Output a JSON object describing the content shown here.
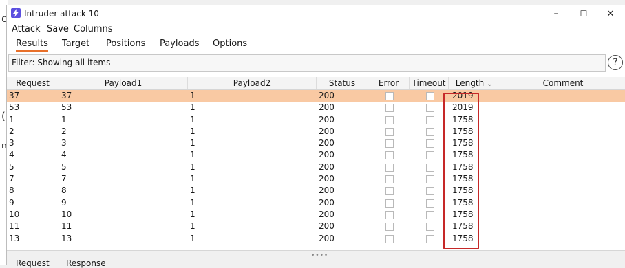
{
  "bg_fragments": [
    "o",
    "(",
    "ne"
  ],
  "window": {
    "title": "Intruder attack 10",
    "minimize": "–",
    "maximize": "☐",
    "close": "✕"
  },
  "menu": [
    "Attack",
    "Save",
    "Columns"
  ],
  "tabs": [
    "Results",
    "Target",
    "Positions",
    "Payloads",
    "Options"
  ],
  "filter": {
    "text": "Filter: Showing all items",
    "help": "?"
  },
  "columns": {
    "request": "Request",
    "payload1": "Payload1",
    "payload2": "Payload2",
    "status": "Status",
    "error": "Error",
    "timeout": "Timeout",
    "length": "Length",
    "length_sort_icon": "⌄",
    "comment": "Comment"
  },
  "rows": [
    {
      "request": "37",
      "payload1": "37",
      "payload2": "1",
      "status": "200",
      "length": "2019"
    },
    {
      "request": "53",
      "payload1": "53",
      "payload2": "1",
      "status": "200",
      "length": "2019"
    },
    {
      "request": "1",
      "payload1": "1",
      "payload2": "1",
      "status": "200",
      "length": "1758"
    },
    {
      "request": "2",
      "payload1": "2",
      "payload2": "1",
      "status": "200",
      "length": "1758"
    },
    {
      "request": "3",
      "payload1": "3",
      "payload2": "1",
      "status": "200",
      "length": "1758"
    },
    {
      "request": "4",
      "payload1": "4",
      "payload2": "1",
      "status": "200",
      "length": "1758"
    },
    {
      "request": "5",
      "payload1": "5",
      "payload2": "1",
      "status": "200",
      "length": "1758"
    },
    {
      "request": "7",
      "payload1": "7",
      "payload2": "1",
      "status": "200",
      "length": "1758"
    },
    {
      "request": "8",
      "payload1": "8",
      "payload2": "1",
      "status": "200",
      "length": "1758"
    },
    {
      "request": "9",
      "payload1": "9",
      "payload2": "1",
      "status": "200",
      "length": "1758"
    },
    {
      "request": "10",
      "payload1": "10",
      "payload2": "1",
      "status": "200",
      "length": "1758"
    },
    {
      "request": "11",
      "payload1": "11",
      "payload2": "1",
      "status": "200",
      "length": "1758"
    },
    {
      "request": "13",
      "payload1": "13",
      "payload2": "1",
      "status": "200",
      "length": "1758"
    }
  ],
  "bottom_tabs": [
    "Request",
    "Response"
  ],
  "splitter_grip": "••••",
  "colors": {
    "selected_row": "#f9c9a3",
    "highlight_box": "#c62828",
    "active_tab": "#e8702a"
  }
}
